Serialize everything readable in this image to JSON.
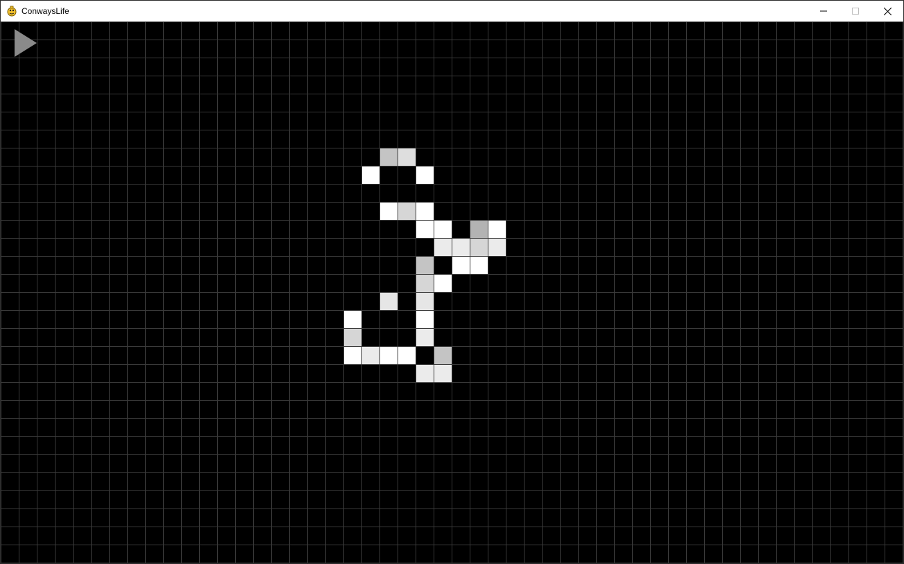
{
  "window": {
    "title": "ConwaysLife",
    "app_icon": "pygame-snake-icon",
    "controls": {
      "minimize_icon": "minimize-icon",
      "maximize_icon": "maximize-icon",
      "close_icon": "close-icon"
    }
  },
  "toolbar": {
    "play_icon": "play-icon",
    "play_color": "#8a8a8a"
  },
  "grid": {
    "background": "#000000",
    "line_color": "#3a3a3a",
    "live_cells": [
      {
        "col": 21,
        "row": 7,
        "shade": "#c4c4c4"
      },
      {
        "col": 22,
        "row": 7,
        "shade": "#dedede"
      },
      {
        "col": 20,
        "row": 8,
        "shade": "#ffffff"
      },
      {
        "col": 23,
        "row": 8,
        "shade": "#ffffff"
      },
      {
        "col": 21,
        "row": 10,
        "shade": "#ffffff"
      },
      {
        "col": 22,
        "row": 10,
        "shade": "#d6d6d6"
      },
      {
        "col": 23,
        "row": 10,
        "shade": "#ffffff"
      },
      {
        "col": 23,
        "row": 11,
        "shade": "#ffffff"
      },
      {
        "col": 24,
        "row": 11,
        "shade": "#ffffff"
      },
      {
        "col": 26,
        "row": 11,
        "shade": "#b3b3b3"
      },
      {
        "col": 27,
        "row": 11,
        "shade": "#ffffff"
      },
      {
        "col": 24,
        "row": 12,
        "shade": "#ebebeb"
      },
      {
        "col": 25,
        "row": 12,
        "shade": "#ebebeb"
      },
      {
        "col": 26,
        "row": 12,
        "shade": "#d6d6d6"
      },
      {
        "col": 27,
        "row": 12,
        "shade": "#ebebeb"
      },
      {
        "col": 23,
        "row": 13,
        "shade": "#c4c4c4"
      },
      {
        "col": 25,
        "row": 13,
        "shade": "#ffffff"
      },
      {
        "col": 26,
        "row": 13,
        "shade": "#ffffff"
      },
      {
        "col": 23,
        "row": 14,
        "shade": "#d6d6d6"
      },
      {
        "col": 24,
        "row": 14,
        "shade": "#ffffff"
      },
      {
        "col": 21,
        "row": 15,
        "shade": "#e6e6e6"
      },
      {
        "col": 23,
        "row": 15,
        "shade": "#e6e6e6"
      },
      {
        "col": 19,
        "row": 16,
        "shade": "#ffffff"
      },
      {
        "col": 23,
        "row": 16,
        "shade": "#ffffff"
      },
      {
        "col": 19,
        "row": 17,
        "shade": "#d6d6d6"
      },
      {
        "col": 23,
        "row": 17,
        "shade": "#ebebeb"
      },
      {
        "col": 19,
        "row": 18,
        "shade": "#ffffff"
      },
      {
        "col": 20,
        "row": 18,
        "shade": "#ebebeb"
      },
      {
        "col": 21,
        "row": 18,
        "shade": "#ffffff"
      },
      {
        "col": 22,
        "row": 18,
        "shade": "#ffffff"
      },
      {
        "col": 24,
        "row": 18,
        "shade": "#c4c4c4"
      },
      {
        "col": 23,
        "row": 19,
        "shade": "#ebebeb"
      },
      {
        "col": 24,
        "row": 19,
        "shade": "#ebebeb"
      }
    ]
  }
}
